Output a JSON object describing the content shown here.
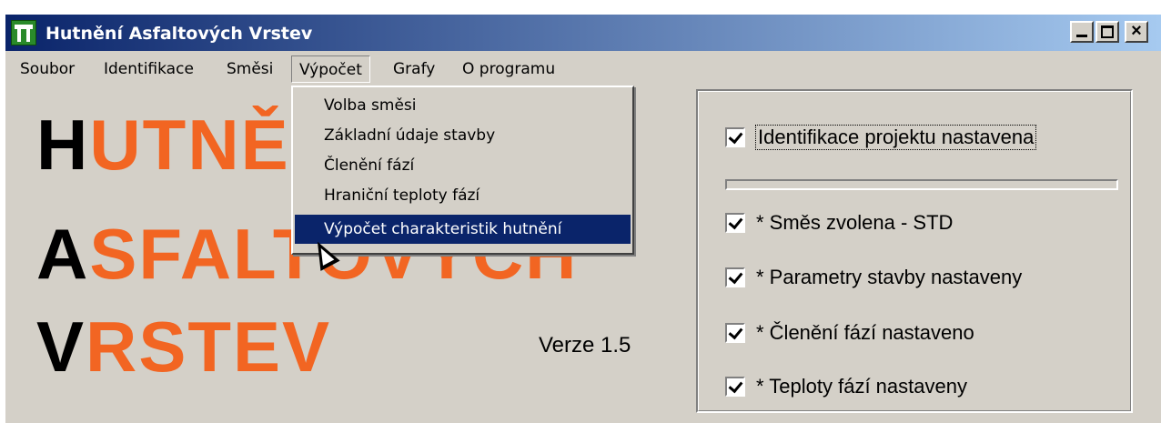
{
  "window": {
    "title": "Hutnění Asfaltových Vrstev",
    "icon": "highway-icon",
    "controls": {
      "minimize": "minimize-icon",
      "maximize": "maximize-icon",
      "close": "×"
    }
  },
  "menubar": {
    "items": [
      "Soubor",
      "Identifikace",
      "Směsi",
      "Výpočet",
      "Grafy",
      "O programu"
    ],
    "open_menu": "Výpočet"
  },
  "dropdown": {
    "items": [
      "Volba směsi",
      "Základní údaje stavby",
      "Členění fází",
      "Hraniční teploty fází",
      "Výpočet charakteristik hutnění"
    ],
    "selected": "Výpočet charakteristik hutnění"
  },
  "logo": {
    "line1": {
      "first": "H",
      "rest": "UTNĚNÍ"
    },
    "line2": {
      "first": "A",
      "rest": "SFALTOVÝCH"
    },
    "line3": {
      "first": "V",
      "rest": "RSTEV"
    },
    "colors": {
      "first": "#000000",
      "rest": "#f26522"
    }
  },
  "version": "Verze 1.5",
  "status": {
    "items": [
      {
        "label": "Identifikace projektu nastavena",
        "checked": true
      },
      {
        "label": "* Směs zvolena - STD",
        "checked": true
      },
      {
        "label": "* Parametry stavby nastaveny",
        "checked": true
      },
      {
        "label": "* Členění fází nastaveno",
        "checked": true
      },
      {
        "label": "* Teploty fází nastaveny",
        "checked": true
      }
    ]
  },
  "colors": {
    "titlebar": "#0a246a",
    "selection": "#0a246a",
    "face": "#d4d0c8",
    "accent": "#f26522"
  }
}
